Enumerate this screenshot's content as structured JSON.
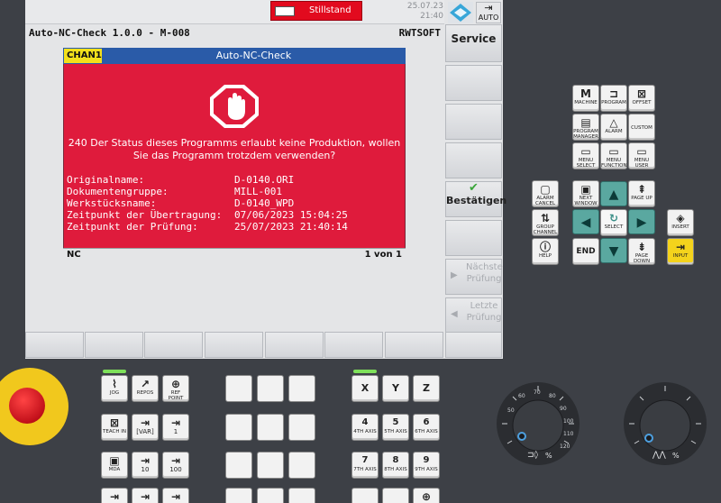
{
  "status": {
    "stillstand": "Stillstand",
    "date": "25.07.23",
    "time": "21:40"
  },
  "title": {
    "left": "Auto-NC-Check 1.0.0 - M-008",
    "right": "RWTSOFT"
  },
  "mode_button": "AUTO",
  "vertical_softkeys": {
    "service": "Service",
    "confirm": "Bestätigen",
    "next_check": "Nächste Prüfung",
    "last_check": "Letzte Prüfung"
  },
  "dialog": {
    "channel": "CHAN1",
    "title": "Auto-NC-Check",
    "message": "240 Der Status dieses Programms erlaubt keine Produktion, wollen Sie das Programm trotzdem verwenden?",
    "fields": [
      {
        "label": "Originalname:",
        "value": "D-0140.ORI"
      },
      {
        "label": "Dokumentengruppe:",
        "value": "MILL-001"
      },
      {
        "label": "Werkstücksname:",
        "value": "D-0140_WPD"
      },
      {
        "label": "Zeitpunkt der Übertragung:",
        "value": "07/06/2023 15:04:25"
      },
      {
        "label": "Zeitpunkt der Prüfung:",
        "value": "25/07/2023 21:40:14"
      }
    ],
    "footer_left": "NC",
    "footer_right": "1 von 1",
    "color": "#df1b3c"
  },
  "hmi_keys": {
    "machine": "MACHINE",
    "program": "PROGRAM",
    "offset": "OFFSET",
    "program_manager": "PROGRAM MANAGER",
    "alarm": "ALARM",
    "custom": "CUSTOM",
    "menu_select": "MENU SELECT",
    "menu_function": "MENU FUNCTION",
    "menu_user": "MENU USER",
    "alarm_cancel": "ALARM CANCEL",
    "next_window": "NEXT WINDOW",
    "page_up": "PAGE UP",
    "group_channel": "GROUP CHANNEL",
    "select": "SELECT",
    "insert": "INSERT",
    "help": "HELP",
    "end": "END",
    "page_down": "PAGE DOWN",
    "input": "INPUT"
  },
  "machine_keys": {
    "jog": "JOG",
    "repos": "REPOS",
    "ref_point": "REF POINT",
    "teach_in": "TEACH IN",
    "var": "[VAR]",
    "one": "1",
    "mda": "MDA",
    "ten": "10",
    "hundred": "100",
    "x": "X",
    "y": "Y",
    "z": "Z",
    "k4": "4",
    "k4s": "4TH AXIS",
    "k5": "5",
    "k5s": "5TH AXIS",
    "k6": "6",
    "k6s": "6TH AXIS",
    "k7": "7",
    "k7s": "7TH AXIS",
    "k8": "8",
    "k8s": "8TH AXIS",
    "k9": "9",
    "k9s": "9TH AXIS"
  },
  "dials": {
    "spindle_scale": [
      "50",
      "60",
      "70",
      "80",
      "90",
      "100",
      "110",
      "120"
    ],
    "spindle_unit": "%",
    "feed_unit": "%"
  }
}
